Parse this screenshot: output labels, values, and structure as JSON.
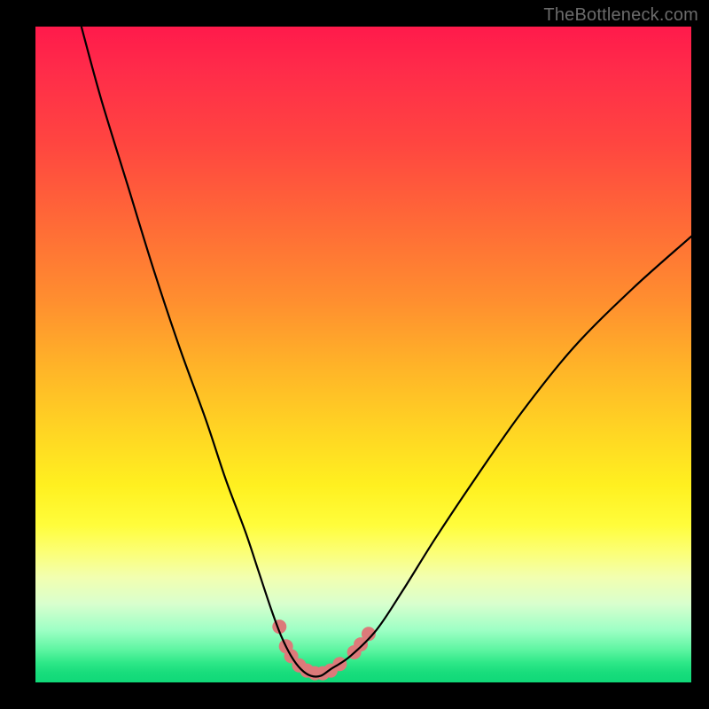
{
  "watermark": "TheBottleneck.com",
  "chart_data": {
    "type": "line",
    "title": "",
    "xlabel": "",
    "ylabel": "",
    "xlim": [
      0,
      100
    ],
    "ylim": [
      0,
      100
    ],
    "grid": false,
    "series": [
      {
        "name": "bottleneck-curve",
        "x": [
          7,
          10,
          14,
          18,
          22,
          26,
          29,
          32,
          34,
          36,
          37.5,
          39,
          40.5,
          42,
          43.5,
          45,
          48,
          52,
          56,
          61,
          67,
          74,
          82,
          91,
          100
        ],
        "y": [
          100,
          89,
          76,
          63,
          51,
          40,
          31,
          23,
          17,
          11,
          7,
          4,
          2,
          1,
          1,
          2,
          4,
          8,
          14,
          22,
          31,
          41,
          51,
          60,
          68
        ]
      }
    ],
    "markers": [
      {
        "name": "dot",
        "x": 37.2,
        "y": 8.5
      },
      {
        "name": "dot",
        "x": 38.2,
        "y": 5.5
      },
      {
        "name": "dot",
        "x": 39.0,
        "y": 4.0
      },
      {
        "name": "dot",
        "x": 40.2,
        "y": 2.6
      },
      {
        "name": "dot",
        "x": 41.4,
        "y": 1.8
      },
      {
        "name": "dot",
        "x": 42.6,
        "y": 1.4
      },
      {
        "name": "dot",
        "x": 43.8,
        "y": 1.4
      },
      {
        "name": "dot",
        "x": 45.0,
        "y": 1.8
      },
      {
        "name": "dot",
        "x": 46.4,
        "y": 2.8
      },
      {
        "name": "dot",
        "x": 48.6,
        "y": 4.6
      },
      {
        "name": "dot",
        "x": 49.6,
        "y": 5.8
      },
      {
        "name": "dot",
        "x": 50.8,
        "y": 7.4
      }
    ],
    "colors": {
      "curve": "#000000",
      "markers": "#dc7a7a"
    }
  }
}
